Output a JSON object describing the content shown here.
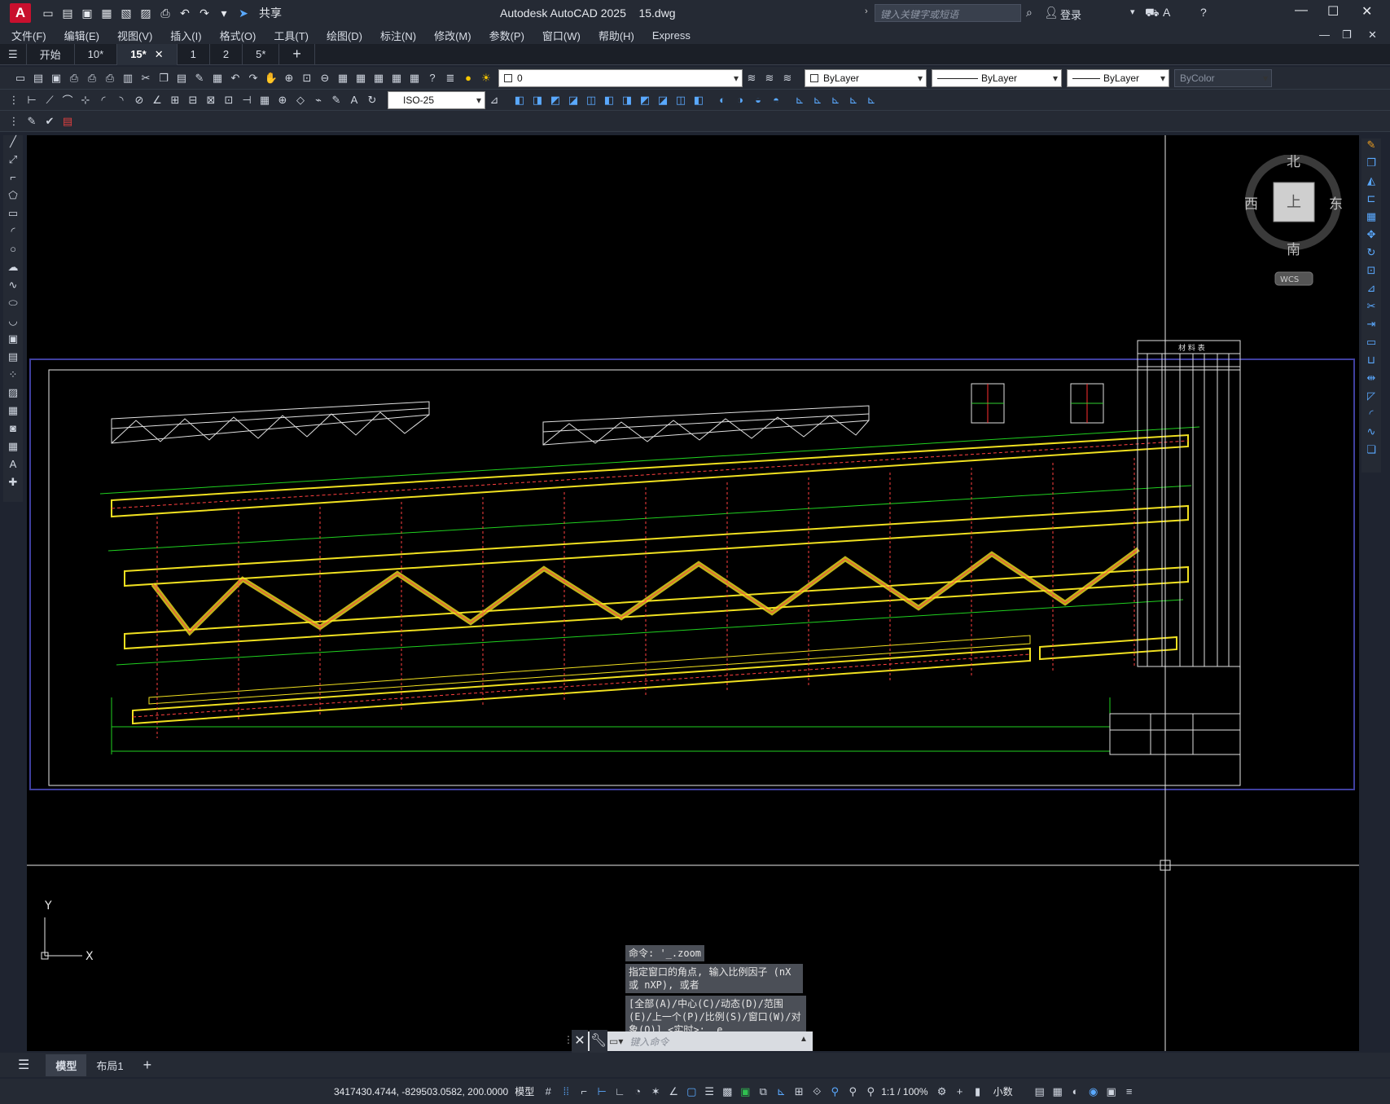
{
  "app": {
    "logo": "A",
    "title": "Autodesk AutoCAD 2025",
    "filename": "15.dwg",
    "search_placeholder": "键入关键字或短语",
    "login": "登录",
    "share": "共享"
  },
  "menu": [
    "文件(F)",
    "编辑(E)",
    "视图(V)",
    "插入(I)",
    "格式(O)",
    "工具(T)",
    "绘图(D)",
    "标注(N)",
    "修改(M)",
    "参数(P)",
    "窗口(W)",
    "帮助(H)",
    "Express"
  ],
  "file_tabs": [
    {
      "label": "开始",
      "active": false
    },
    {
      "label": "10*",
      "active": false
    },
    {
      "label": "15*",
      "active": true
    },
    {
      "label": "1",
      "active": false
    },
    {
      "label": "2",
      "active": false
    },
    {
      "label": "5*",
      "active": false
    }
  ],
  "properties": {
    "layer": "0",
    "color": "ByLayer",
    "linetype": "ByLayer",
    "lineweight": "ByLayer",
    "plotstyle": "ByColor",
    "dimstyle": "ISO-25"
  },
  "viewcube": {
    "north": "北",
    "south": "南",
    "east": "东",
    "west": "西",
    "top": "上",
    "wcs": "WCS"
  },
  "ucs": {
    "x": "X",
    "y": "Y"
  },
  "command_history": [
    "命令: '_.zoom",
    "指定窗口的角点, 输入比例因子 (nX 或 nXP), 或者",
    "[全部(A)/中心(C)/动态(D)/范围(E)/上一个(P)/比例(S)/窗口(W)/对象(O)] <实时>: _e"
  ],
  "command_input_placeholder": "键入命令",
  "layout_tabs": [
    {
      "label": "模型",
      "active": true
    },
    {
      "label": "布局1",
      "active": false
    }
  ],
  "status": {
    "coordinates": "3417430.4744, -829503.0582, 200.0000",
    "model": "模型",
    "scale": "1:1 / 100%",
    "units": "小数"
  },
  "drawing_labels": {
    "table_title": "材 料 表"
  }
}
